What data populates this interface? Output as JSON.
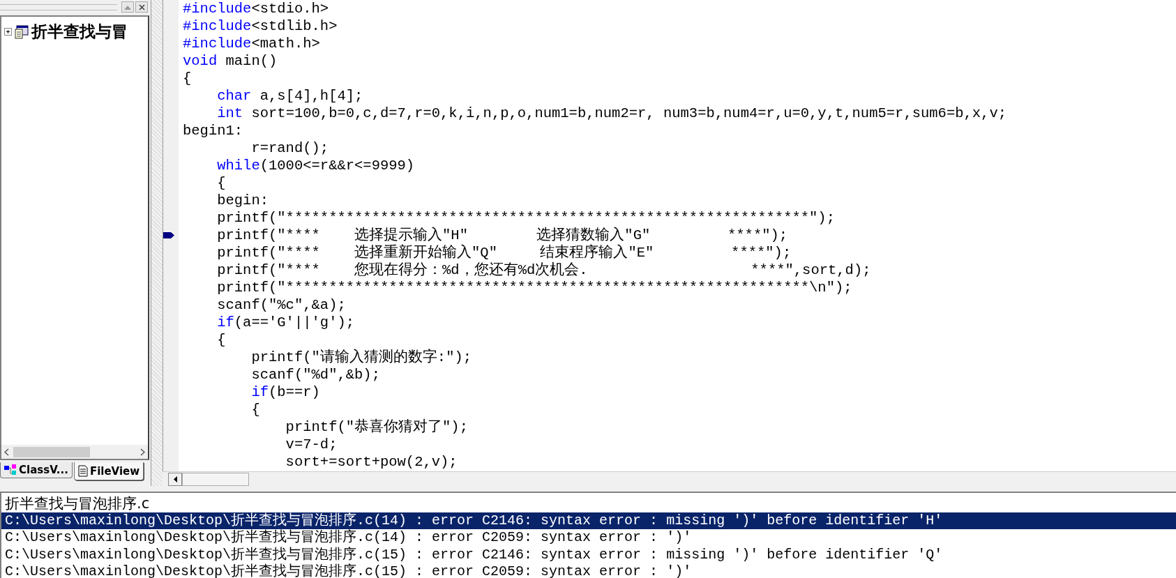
{
  "workspace": {
    "tree": [
      {
        "label": "折半查找与冒",
        "expanded": false
      }
    ],
    "tabs": [
      {
        "label": "ClassV...",
        "kind": "classes",
        "selected": false
      },
      {
        "label": "FileView",
        "kind": "files",
        "selected": true
      }
    ]
  },
  "editor": {
    "lines": [
      {
        "marked": false,
        "tokens": [
          {
            "kind": "keyword",
            "text": "#include"
          },
          {
            "kind": "plain",
            "text": "<stdio.h>"
          }
        ]
      },
      {
        "marked": false,
        "tokens": [
          {
            "kind": "keyword",
            "text": "#include"
          },
          {
            "kind": "plain",
            "text": "<stdlib.h>"
          }
        ]
      },
      {
        "marked": false,
        "tokens": [
          {
            "kind": "keyword",
            "text": "#include"
          },
          {
            "kind": "plain",
            "text": "<math.h>"
          }
        ]
      },
      {
        "marked": false,
        "tokens": [
          {
            "kind": "keyword",
            "text": "void"
          },
          {
            "kind": "plain",
            "text": " main()"
          }
        ]
      },
      {
        "marked": false,
        "tokens": [
          {
            "kind": "plain",
            "text": "{"
          }
        ]
      },
      {
        "marked": false,
        "tokens": [
          {
            "kind": "keyword",
            "text": "    char"
          },
          {
            "kind": "plain",
            "text": " a,s[4],h[4];"
          }
        ]
      },
      {
        "marked": false,
        "tokens": [
          {
            "kind": "keyword",
            "text": "    int"
          },
          {
            "kind": "plain",
            "text": " sort=100,b=0,c,d=7,r=0,k,i,n,p,o,num1=b,num2=r, num3=b,num4=r,u=0,y,t,num5=r,sum6=b,x,v;"
          }
        ]
      },
      {
        "marked": false,
        "tokens": [
          {
            "kind": "plain",
            "text": "begin1:"
          }
        ]
      },
      {
        "marked": false,
        "tokens": [
          {
            "kind": "plain",
            "text": "        r=rand();"
          }
        ]
      },
      {
        "marked": false,
        "tokens": [
          {
            "kind": "keyword",
            "text": "    while"
          },
          {
            "kind": "plain",
            "text": "(1000<=r&&r<=9999)"
          }
        ]
      },
      {
        "marked": false,
        "tokens": [
          {
            "kind": "plain",
            "text": "    {"
          }
        ]
      },
      {
        "marked": false,
        "tokens": [
          {
            "kind": "plain",
            "text": "    begin:"
          }
        ]
      },
      {
        "marked": false,
        "tokens": [
          {
            "kind": "plain",
            "text": "    printf(\"*************************************************************\");"
          }
        ]
      },
      {
        "marked": true,
        "tokens": [
          {
            "kind": "plain",
            "text": "    printf(\"****    选择提示输入\"H\"        选择猜数输入\"G\"         ****\");"
          }
        ]
      },
      {
        "marked": false,
        "tokens": [
          {
            "kind": "plain",
            "text": "    printf(\"****    选择重新开始输入\"Q\"     结束程序输入\"E\"         ****\");"
          }
        ]
      },
      {
        "marked": false,
        "tokens": [
          {
            "kind": "plain",
            "text": "    printf(\"****    您现在得分：%d，您还有%d次机会.                   ****\",sort,d);"
          }
        ]
      },
      {
        "marked": false,
        "tokens": [
          {
            "kind": "plain",
            "text": "    printf(\"*************************************************************\\n\");"
          }
        ]
      },
      {
        "marked": false,
        "tokens": [
          {
            "kind": "plain",
            "text": "    scanf(\"%c\",&a);"
          }
        ]
      },
      {
        "marked": false,
        "tokens": [
          {
            "kind": "keyword",
            "text": "    if"
          },
          {
            "kind": "plain",
            "text": "(a=='G'||'g');"
          }
        ]
      },
      {
        "marked": false,
        "tokens": [
          {
            "kind": "plain",
            "text": "    {"
          }
        ]
      },
      {
        "marked": false,
        "tokens": [
          {
            "kind": "plain",
            "text": "        printf(\"请输入猜测的数字:\");"
          }
        ]
      },
      {
        "marked": false,
        "tokens": [
          {
            "kind": "plain",
            "text": "        scanf(\"%d\",&b);"
          }
        ]
      },
      {
        "marked": false,
        "tokens": [
          {
            "kind": "keyword",
            "text": "        if"
          },
          {
            "kind": "plain",
            "text": "(b==r)"
          }
        ]
      },
      {
        "marked": false,
        "tokens": [
          {
            "kind": "plain",
            "text": "        {"
          }
        ]
      },
      {
        "marked": false,
        "tokens": [
          {
            "kind": "plain",
            "text": "            printf(\"恭喜你猜对了\");"
          }
        ]
      },
      {
        "marked": false,
        "tokens": [
          {
            "kind": "plain",
            "text": "            v=7-d;"
          }
        ]
      },
      {
        "marked": false,
        "tokens": [
          {
            "kind": "plain",
            "text": "            sort+=sort+pow(2,v);"
          }
        ]
      }
    ]
  },
  "output": {
    "lines": [
      {
        "kind": "file",
        "text": "折半查找与冒泡排序.c",
        "selected": false
      },
      {
        "kind": "message",
        "text": "C:\\Users\\maxinlong\\Desktop\\折半查找与冒泡排序.c(14) : error C2146: syntax error : missing ')' before identifier 'H'",
        "selected": true
      },
      {
        "kind": "message",
        "text": "C:\\Users\\maxinlong\\Desktop\\折半查找与冒泡排序.c(14) : error C2059: syntax error : ')'",
        "selected": false
      },
      {
        "kind": "message",
        "text": "C:\\Users\\maxinlong\\Desktop\\折半查找与冒泡排序.c(15) : error C2146: syntax error : missing ')' before identifier 'Q'",
        "selected": false
      },
      {
        "kind": "message",
        "text": "C:\\Users\\maxinlong\\Desktop\\折半查找与冒泡排序.c(15) : error C2059: syntax error : ')'",
        "selected": false
      }
    ]
  }
}
